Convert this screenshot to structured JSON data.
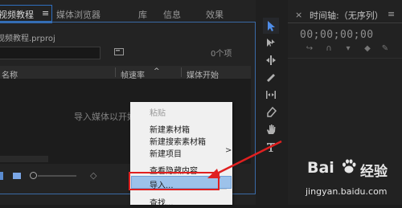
{
  "project_panel": {
    "tabs": [
      {
        "label": "视频教程"
      },
      {
        "label": "媒体浏览器"
      },
      {
        "label": "库"
      },
      {
        "label": "信息"
      },
      {
        "label": "效果"
      }
    ],
    "menu_glyph": "≡",
    "project_file": "视频教程.prproj",
    "search": {
      "value": "",
      "placeholder": ""
    },
    "item_count": "0个项",
    "columns": {
      "name": "名称",
      "frame_rate": "帧速率",
      "sort_indicator": "^",
      "media_start": "媒体开始"
    },
    "empty_hint": "导入媒体以开始"
  },
  "context_menu": {
    "items": [
      {
        "label": "粘贴",
        "enabled": false
      },
      {
        "label": "新建素材箱",
        "enabled": true
      },
      {
        "label": "新建搜索素材箱",
        "enabled": true
      },
      {
        "label": "新建项目",
        "enabled": true,
        "has_submenu": true
      },
      {
        "label": "查看隐藏内容",
        "enabled": true
      },
      {
        "label": "导入...",
        "enabled": true,
        "highlighted": true
      },
      {
        "label": "查找...",
        "enabled": true
      }
    ],
    "submenu_arrow": ">"
  },
  "tools": [
    "selection-tool",
    "track-select-tool",
    "ripple-edit-tool",
    "razor-tool",
    "slip-tool",
    "pen-tool",
    "hand-tool",
    "type-tool"
  ],
  "timeline": {
    "close_glyph": "×",
    "title": "时间轴:（无序列）",
    "menu_glyph": "≡",
    "timecode": "00;00;00;00"
  },
  "watermark": {
    "logo_left": "Bai",
    "logo_right": "经验",
    "url": "jingyan.baidu.com"
  },
  "colors": {
    "panel_bg": "#232323",
    "accent_blue": "#2f6fbf",
    "menu_bg": "#f0f0f0",
    "menu_highlight": "#9dc2ea",
    "annotation_red": "#e02020"
  }
}
